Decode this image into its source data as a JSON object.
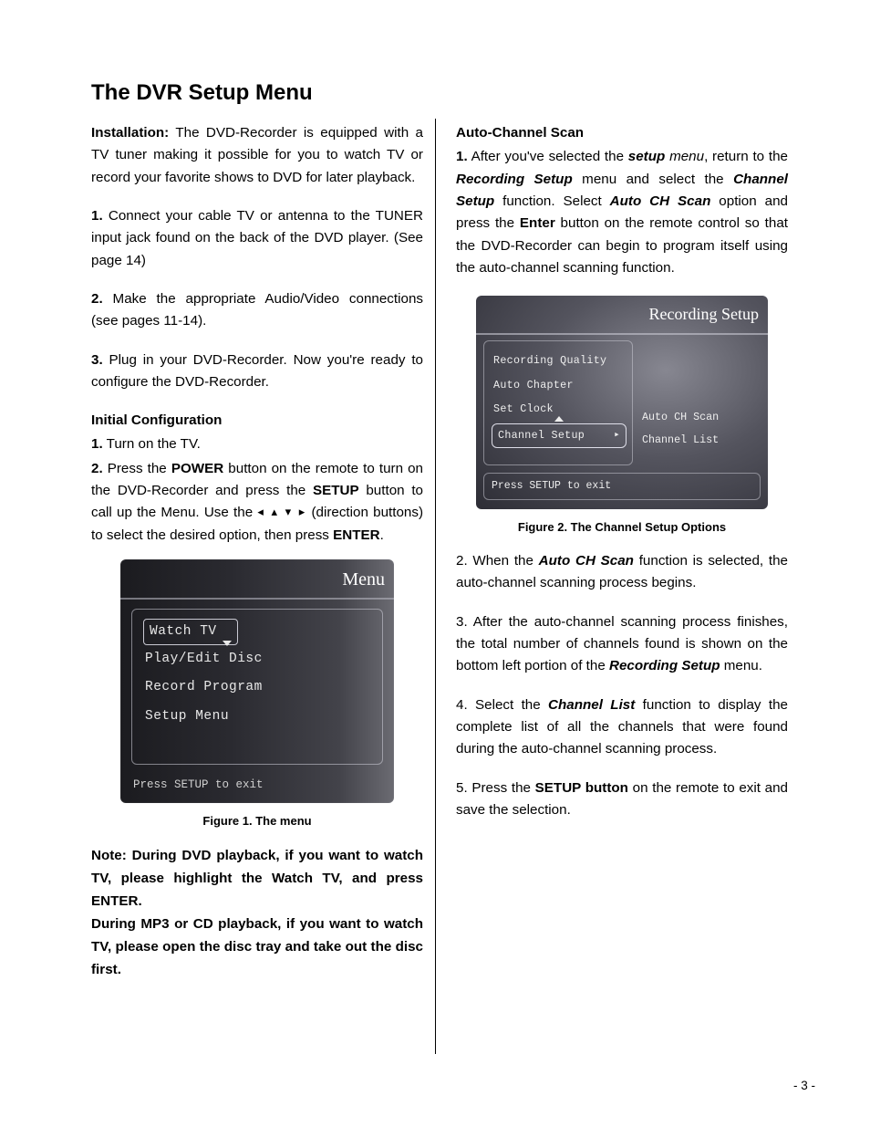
{
  "title": "The DVR Setup Menu",
  "left": {
    "install_run": {
      "label": "Installation:",
      "text": " The DVD-Recorder is equipped with a TV tuner making it possible for you to watch TV or record your favorite shows to DVD for later playback."
    },
    "step1": {
      "num": "1.",
      "text": " Connect your cable TV or antenna to the TUNER input jack found on the back of the DVD player. (See page 14)"
    },
    "step2": {
      "num": "2.",
      "text": " Make the appropriate Audio/Video connections (see pages 11-14)."
    },
    "step3": {
      "num": "3.",
      "text": " Plug in your DVD-Recorder. Now you're ready to configure the DVD-Recorder."
    },
    "initconf_head": "Initial Configuration",
    "ic1": {
      "num": "1.",
      "text": "   Turn on the TV."
    },
    "ic2": {
      "num": "2.",
      "a": "   Press the ",
      "b_power": "POWER",
      "c": " button on the remote to turn on the DVD-Recorder and press the ",
      "d_setup": "SETUP",
      "e": " button to call up the Menu. Use the  ",
      "arrows": "◂ ▴ ▾ ▸",
      "f": " (direction buttons) to select the desired option, then press ",
      "g_enter": "ENTER",
      "h": "."
    },
    "fig1_caption": "Figure 1. The menu",
    "note": "Note: During DVD playback, if you want to watch TV, please highlight the Watch TV, and press ENTER.\nDuring MP3 or CD playback, if you want to watch TV, please open the disc tray and take out the disc first."
  },
  "right": {
    "acs_head": "Auto-Channel Scan",
    "acs1": {
      "num": "1.",
      "a": " After you've selected the ",
      "b_setup": "setup",
      "c": " ",
      "d_menu": "menu",
      "e": ", return to the ",
      "f_rec": "Recording Setup",
      "g": " menu and select the ",
      "h_ch": "Channel Setup",
      "i": " function. Select ",
      "j_auto": "Auto CH Scan",
      "k": " option and press the ",
      "l_enter": "Enter",
      "m": " button on the remote control so that the DVD-Recorder can begin to program itself using the auto-channel scanning function."
    },
    "fig2_caption": "Figure 2. The Channel Setup Options",
    "acs2": {
      "pre": "2. When the ",
      "b": "Auto CH Scan",
      "post": " function is selected, the auto-channel scanning process begins."
    },
    "acs3": {
      "pre": "3. After the auto-channel scanning process finishes, the total number of channels found is shown on the bottom left portion of the ",
      "b": "Recording Setup",
      "post": " menu."
    },
    "acs4": {
      "pre": "4. Select the ",
      "b": "Channel List",
      "post": " function to display the complete list of all the channels that were found during the auto-channel scanning process."
    },
    "acs5": {
      "pre": "5. Press the ",
      "b": "SETUP button",
      "post": " on the remote to exit and save the selection."
    }
  },
  "osd1": {
    "title": "Menu",
    "items": [
      "Watch TV",
      "Play/Edit Disc",
      "Record Program",
      "Setup Menu"
    ],
    "hint": "Press SETUP to exit"
  },
  "osd2": {
    "title": "Recording Setup",
    "left_items": [
      "Recording Quality",
      "Auto Chapter",
      "Set Clock",
      "Channel Setup"
    ],
    "right_items": [
      "Auto CH Scan",
      "Channel List"
    ],
    "hint": "Press SETUP to exit"
  },
  "page_number": "- 3 -"
}
